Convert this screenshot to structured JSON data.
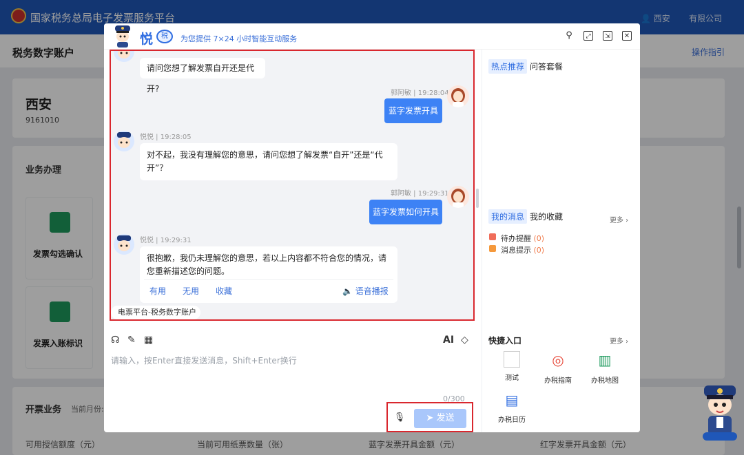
{
  "background": {
    "site_title": "国家税务总局电子发票服务平台",
    "user": "西安",
    "company_short": "有限公司",
    "sub_title": "税务数字账户",
    "guide_link": "操作指引",
    "company_name": "西安",
    "company_tax_id": "9161010",
    "biz_title": "业务办理",
    "biz_items": [
      "发票勾选确认",
      "发票入账标识"
    ],
    "invoice_title": "开票业务",
    "invoice_month": "当前月份:",
    "stats": [
      "可用授信额度（元）",
      "当前可用纸票数量（张）",
      "蓝字发票开具金额（元）",
      "红字发票开具金额（元）"
    ]
  },
  "modal": {
    "brand": "悦",
    "badge": "税",
    "tagline": "为您提供 7×24 小时智能互动服务",
    "messages": {
      "m1_text": "请问您想了解发票自开还是代开?",
      "m2_meta": "郭阿敏 | 19:28:04",
      "m2_text": "蓝字发票开具",
      "m3_meta": "悦悦 | 19:28:05",
      "m3_text": "对不起，我没有理解您的意思，请问您想了解发票“自开”还是“代开”？",
      "m4_meta": "郭阿敏 | 19:29:31",
      "m4_text": "蓝字发票如何开具",
      "m5_meta": "悦悦 | 19:29:31",
      "m5_text": "很抱歉，我仍未理解您的意思，若以上内容都不符合您的情况，请您重新描述您的问题。",
      "actions": [
        "有用",
        "无用",
        "收藏"
      ],
      "voice": "语音播报"
    },
    "source_tag": "电票平台-税务数字账户",
    "input_placeholder": "请输入，按Enter直接发送消息，Shift+Enter换行",
    "char_count": "0/300",
    "ai_label": "AI",
    "send_label": "发送"
  },
  "right_panel": {
    "hot_tabs": [
      "热点推荐",
      "问答套餐"
    ],
    "msg_tabs": [
      "我的消息",
      "我的收藏"
    ],
    "more": "更多",
    "msg_items": [
      {
        "label": "待办提醒",
        "count": "(0)",
        "color": "#f06d5a"
      },
      {
        "label": "消息提示",
        "count": "(0)",
        "color": "#f5993c"
      }
    ],
    "quick_title": "快捷入口",
    "quick_items": [
      {
        "label": "测试",
        "icon": "broken-image-icon",
        "color": "#999999"
      },
      {
        "label": "办税指南",
        "icon": "compass-icon",
        "color": "#e84b3c"
      },
      {
        "label": "办税地图",
        "icon": "map-icon",
        "color": "#1e9a5d"
      },
      {
        "label": "办税日历",
        "icon": "calendar-icon",
        "color": "#2f6de1"
      }
    ]
  }
}
